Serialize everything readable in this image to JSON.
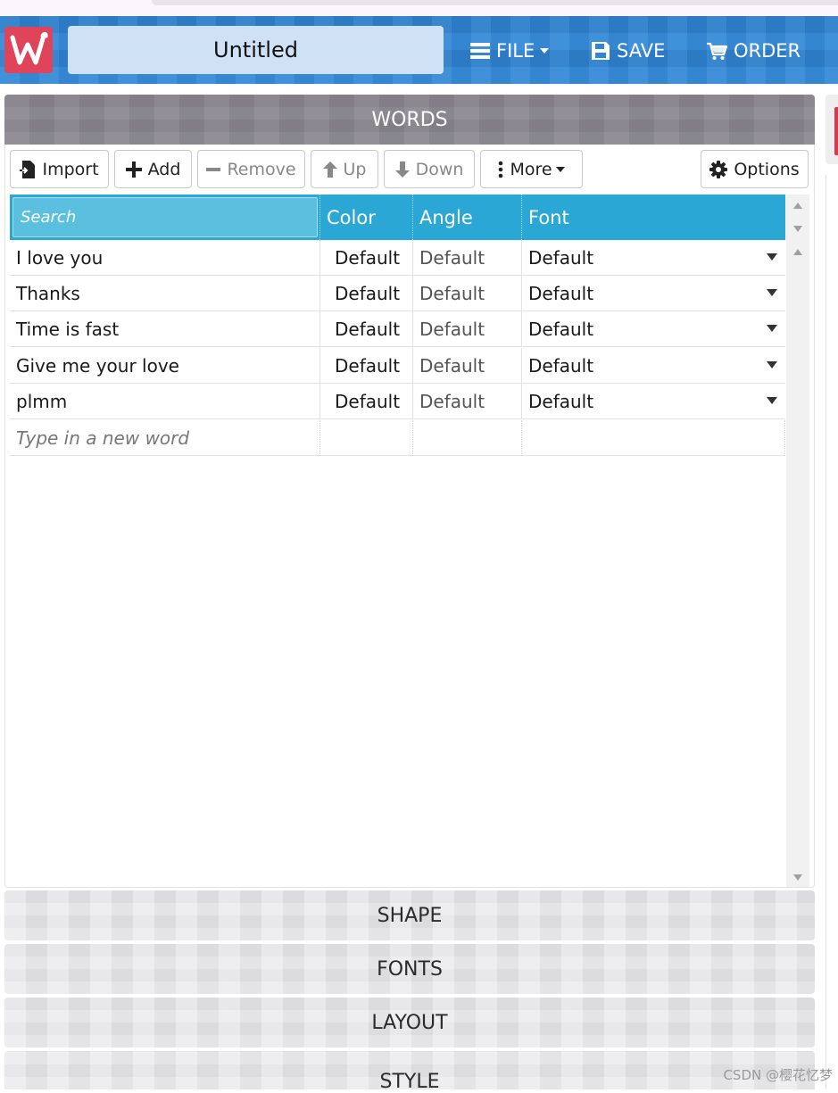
{
  "header": {
    "logo_letter": "W",
    "title_value": "Untitled",
    "file_label": "FILE",
    "save_label": "SAVE",
    "order_label": "ORDER",
    "colors": {
      "bar": "#2f86d6",
      "logo": "#e0445b"
    }
  },
  "words_panel": {
    "title": "WORDS",
    "toolbar": {
      "import": "Import",
      "add": "Add",
      "remove": "Remove",
      "up": "Up",
      "down": "Down",
      "more": "More",
      "options": "Options"
    },
    "table": {
      "search_placeholder": "Search",
      "columns": [
        "Color",
        "Angle",
        "Font"
      ],
      "rows": [
        {
          "word": "I love you",
          "color": "Default",
          "angle": "Default",
          "font": "Default"
        },
        {
          "word": "Thanks",
          "color": "Default",
          "angle": "Default",
          "font": "Default"
        },
        {
          "word": "Time is fast",
          "color": "Default",
          "angle": "Default",
          "font": "Default"
        },
        {
          "word": "Give me your love",
          "color": "Default",
          "angle": "Default",
          "font": "Default"
        },
        {
          "word": "plmm",
          "color": "Default",
          "angle": "Default",
          "font": "Default"
        }
      ],
      "new_word_placeholder": "Type in a new word"
    }
  },
  "sections": [
    "SHAPE",
    "FONTS",
    "LAYOUT",
    "STYLE"
  ],
  "watermark": "CSDN @樱花忆梦"
}
